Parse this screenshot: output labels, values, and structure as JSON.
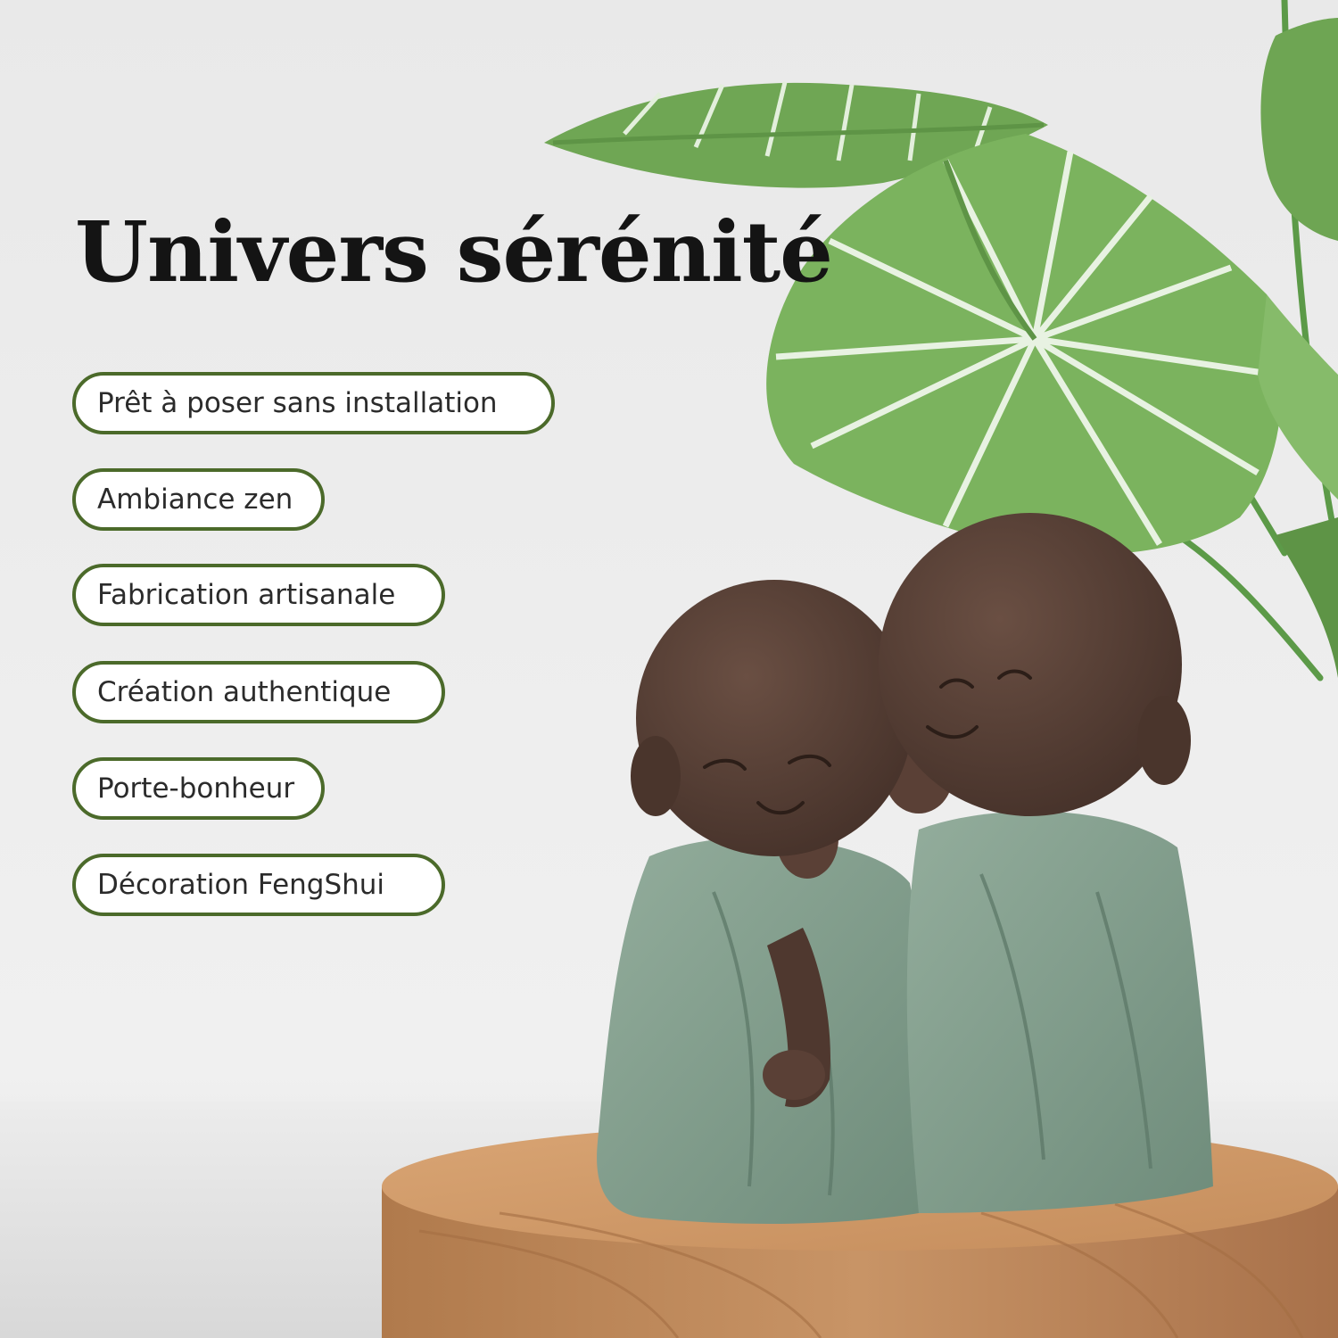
{
  "title": "Univers sérénité",
  "features": [
    "Prêt à poser sans installation",
    "Ambiance zen",
    "Fabrication artisanale",
    "Création authentique",
    "Porte-bonheur",
    "Décoration FengShui"
  ],
  "colors": {
    "background": "#ececec",
    "pill_border": "#4b6a2a",
    "title": "#141414",
    "leaf": "#74ab5a",
    "robe": "#7f9c8a",
    "skin": "#533c33",
    "wood": "#c08a5a"
  }
}
